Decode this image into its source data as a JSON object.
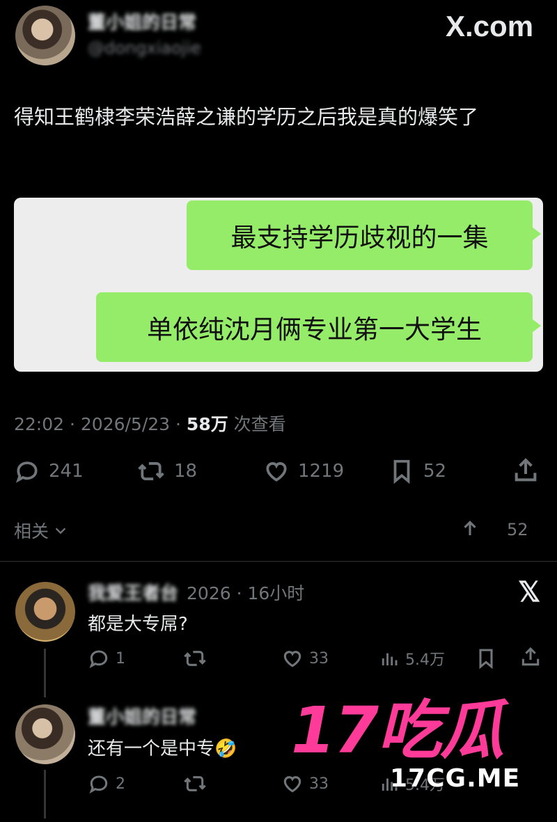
{
  "header": {
    "author_name": "董小姐的日常",
    "author_handle": "@dongxiaojie",
    "site_logo": "X.com"
  },
  "tweet": {
    "text": "得知王鹤棣李荣浩薛之谦的学历之后我是真的爆笑了",
    "bubble1": "最支持学历歧视的一集",
    "bubble2": "单依纯沈月俩专业第一大学生",
    "time": "22:02 · 2026/5/23 · ",
    "views_count": "58万",
    "views_label": " 次查看",
    "stats": {
      "replies": "241",
      "retweets": "18",
      "likes": "1219",
      "bookmarks": "52"
    }
  },
  "related": {
    "label": "相关",
    "count": "52"
  },
  "replies": [
    {
      "name": "我爱王者台",
      "meta": "2026 · 16小时",
      "text": "都是大专屌?",
      "stats": {
        "replies": "1",
        "retweets": "",
        "likes": "33",
        "views": "5.4万"
      }
    },
    {
      "name": "董小姐的日常",
      "text": "还有一个是中专🤣",
      "stats": {
        "replies": "2",
        "retweets": "",
        "likes": "33",
        "views": "5.4万"
      }
    }
  ],
  "watermark": {
    "big": "17吃瓜",
    "small": "17CG.ME"
  },
  "colors": {
    "bg": "#000000",
    "text": "#e7e9ea",
    "muted": "#71767b",
    "bubble": "#95ec69",
    "card": "#ededed",
    "watermark": "#ff3b9a"
  },
  "icons": [
    "reply-icon",
    "retweet-icon",
    "like-icon",
    "bookmark-icon",
    "share-icon",
    "views-icon",
    "x-logo-icon",
    "chevron-down-icon",
    "arrow-up-icon"
  ]
}
